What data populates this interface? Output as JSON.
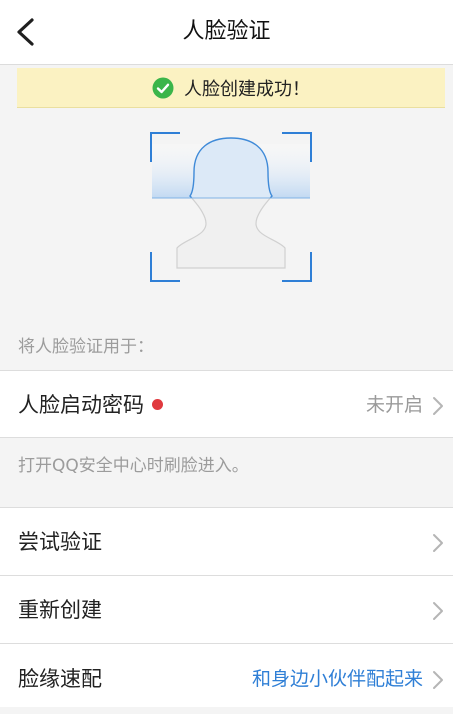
{
  "header": {
    "title": "人脸验证"
  },
  "banner": {
    "message": "人脸创建成功！",
    "color": "#fbf2c2",
    "check_color": "#3bb54a"
  },
  "face_scan": {
    "icon": "face-silhouette-icon"
  },
  "section": {
    "label": "将人脸验证用于："
  },
  "face_password_row": {
    "label": "人脸启动密码",
    "value": "未开启",
    "badge_color": "#e0393e"
  },
  "hint": {
    "text": "打开QQ安全中心时刷脸进入。"
  },
  "rows": [
    {
      "label": "尝试验证",
      "value": ""
    },
    {
      "label": "重新创建",
      "value": ""
    },
    {
      "label": "脸缘速配",
      "value": "和身边小伙伴配起来",
      "value_color": "#2f7fd6"
    }
  ]
}
